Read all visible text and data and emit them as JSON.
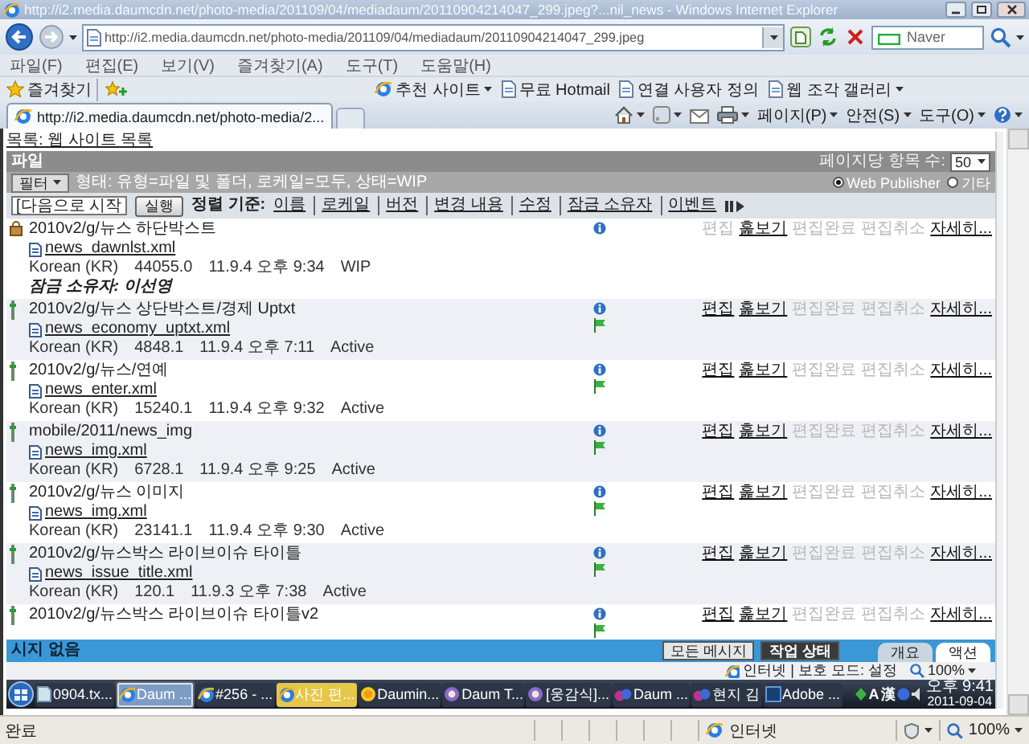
{
  "window": {
    "title": "http://i2.media.daumcdn.net/photo-media/201109/04/mediadaum/20110904214047_299.jpeg?...nil_news - Windows Internet Explorer"
  },
  "address_bar": {
    "url": "http://i2.media.daumcdn.net/photo-media/201109/04/mediadaum/20110904214047_299.jpeg"
  },
  "search": {
    "placeholder": "Naver"
  },
  "menu": [
    "파일(F)",
    "편집(E)",
    "보기(V)",
    "즐겨찾기(A)",
    "도구(T)",
    "도움말(H)"
  ],
  "favorites_bar": {
    "label": "즐겨찾기",
    "links": [
      {
        "label": "추천 사이트",
        "dropdown": true
      },
      {
        "label": "무료 Hotmail",
        "dropdown": false
      },
      {
        "label": "연결 사용자 정의",
        "dropdown": false
      },
      {
        "label": "웹 조각 갤러리",
        "dropdown": true
      }
    ]
  },
  "tab": {
    "label": "http://i2.media.daumcdn.net/photo-media/2..."
  },
  "command_bar": [
    {
      "label": "페이지(P)"
    },
    {
      "label": "안전(S)"
    },
    {
      "label": "도구(O)"
    }
  ],
  "screenshot": {
    "breadcrumb": "목록: 웹 사이트 목록",
    "panel_title": "파일",
    "per_page_label": "페이지당 항목 수:",
    "per_page": "50",
    "filter_button": "필터",
    "filter_text": "형태: 유형=파일 및 폴더, 로케일=모두, 상태=WIP",
    "view_options": [
      {
        "label": "Web Publisher",
        "selected": true
      },
      {
        "label": "기타",
        "selected": false
      }
    ],
    "search": {
      "placeholder": "[다음으로 시작"
    },
    "go_button": "실행",
    "sort_label": "정렬 기준:",
    "sort_links": [
      "이름",
      "로케일",
      "버전",
      "변경 내용",
      "수정",
      "잠금 소유자",
      "이벤트"
    ],
    "items": [
      {
        "locked": true,
        "flag": false,
        "path": "2010v2/g/뉴스 하단박스트",
        "file": "news_dawnlst.xml",
        "language": "Korean (KR)",
        "size": "44055.0",
        "modified": "11.9.4 오후 9:34",
        "status": "WIP",
        "lock_owner": "잠금 소유자: 이선영",
        "actions": [
          {
            "label": "편집",
            "enabled": false
          },
          {
            "label": "훑보기",
            "enabled": true
          },
          {
            "label": "편집완료",
            "enabled": false
          },
          {
            "label": "편집취소",
            "enabled": false
          },
          {
            "label": "자세히...",
            "enabled": true
          }
        ]
      },
      {
        "locked": false,
        "flag": true,
        "path": "2010v2/g/뉴스 상단박스트/경제 Uptxt",
        "file": "news_economy_uptxt.xml",
        "language": "Korean (KR)",
        "size": "4848.1",
        "modified": "11.9.4 오후 7:11",
        "status": "Active",
        "actions": [
          {
            "label": "편집",
            "enabled": true
          },
          {
            "label": "훑보기",
            "enabled": true
          },
          {
            "label": "편집완료",
            "enabled": false
          },
          {
            "label": "편집취소",
            "enabled": false
          },
          {
            "label": "자세히...",
            "enabled": true
          }
        ]
      },
      {
        "locked": false,
        "flag": true,
        "path": "2010v2/g/뉴스/연예",
        "file": "news_enter.xml",
        "language": "Korean (KR)",
        "size": "15240.1",
        "modified": "11.9.4 오후 9:32",
        "status": "Active",
        "actions": [
          {
            "label": "편집",
            "enabled": true
          },
          {
            "label": "훑보기",
            "enabled": true
          },
          {
            "label": "편집완료",
            "enabled": false
          },
          {
            "label": "편집취소",
            "enabled": false
          },
          {
            "label": "자세히...",
            "enabled": true
          }
        ]
      },
      {
        "locked": false,
        "flag": true,
        "path": "mobile/2011/news_img",
        "file": "news_img.xml",
        "language": "Korean (KR)",
        "size": "6728.1",
        "modified": "11.9.4 오후 9:25",
        "status": "Active",
        "actions": [
          {
            "label": "편집",
            "enabled": true
          },
          {
            "label": "훑보기",
            "enabled": true
          },
          {
            "label": "편집완료",
            "enabled": false
          },
          {
            "label": "편집취소",
            "enabled": false
          },
          {
            "label": "자세히...",
            "enabled": true
          }
        ]
      },
      {
        "locked": false,
        "flag": true,
        "path": "2010v2/g/뉴스 이미지",
        "file": "news_img.xml",
        "language": "Korean (KR)",
        "size": "23141.1",
        "modified": "11.9.4 오후 9:30",
        "status": "Active",
        "actions": [
          {
            "label": "편집",
            "enabled": true
          },
          {
            "label": "훑보기",
            "enabled": true
          },
          {
            "label": "편집완료",
            "enabled": false
          },
          {
            "label": "편집취소",
            "enabled": false
          },
          {
            "label": "자세히...",
            "enabled": true
          }
        ]
      },
      {
        "locked": false,
        "flag": true,
        "path": "2010v2/g/뉴스박스 라이브이슈 타이틀",
        "file": "news_issue_title.xml",
        "language": "Korean (KR)",
        "size": "120.1",
        "modified": "11.9.3 오후 7:38",
        "status": "Active",
        "actions": [
          {
            "label": "편집",
            "enabled": true
          },
          {
            "label": "훑보기",
            "enabled": true
          },
          {
            "label": "편집완료",
            "enabled": false
          },
          {
            "label": "편집취소",
            "enabled": false
          },
          {
            "label": "자세히...",
            "enabled": true
          }
        ]
      },
      {
        "locked": false,
        "flag": true,
        "path": "2010v2/g/뉴스박스 라이브이슈 타이틀v2",
        "actions": [
          {
            "label": "편집",
            "enabled": true
          },
          {
            "label": "훑보기",
            "enabled": true
          },
          {
            "label": "편집완료",
            "enabled": false
          },
          {
            "label": "편집취소",
            "enabled": false
          },
          {
            "label": "자세히...",
            "enabled": true
          }
        ]
      }
    ],
    "message": "시지 없음",
    "buttons": [
      {
        "label": "모든 메시지",
        "selected": false
      },
      {
        "label": "작업 상태",
        "selected": true
      }
    ],
    "tabs": [
      {
        "label": "개요",
        "selected": false
      },
      {
        "label": "액션",
        "selected": true
      }
    ],
    "status_bar": {
      "zone": "인터넷 | 보호 모드: 설정",
      "zoom": "100%"
    },
    "taskbar": {
      "items": [
        {
          "label": "0904.tx...",
          "kind": "document",
          "selected": false,
          "attention": false
        },
        {
          "label": "Daum ...",
          "kind": "browser",
          "selected": true,
          "attention": false
        },
        {
          "label": "#256 - ...",
          "kind": "browser",
          "selected": false,
          "attention": false
        },
        {
          "label": "사진 편...",
          "kind": "browser",
          "selected": false,
          "attention": true
        },
        {
          "label": "Daumin...",
          "kind": "sun",
          "selected": false,
          "attention": false
        },
        {
          "label": "Daum T...",
          "kind": "round",
          "selected": false,
          "attention": false
        },
        {
          "label": "[웅감식]...",
          "kind": "round",
          "selected": false,
          "attention": false
        },
        {
          "label": "Daum ...",
          "kind": "messenger",
          "selected": false,
          "attention": false
        },
        {
          "label": "현지 김",
          "kind": "messenger",
          "selected": false,
          "attention": false
        },
        {
          "label": "Adobe ...",
          "kind": "square",
          "selected": false,
          "attention": false
        }
      ],
      "ime": [
        "A",
        "漢"
      ],
      "time": "오후 9:41",
      "date": "2011-09-04"
    }
  },
  "status_bar": {
    "text": "완료",
    "zone": "인터넷",
    "zoom": "100%"
  }
}
